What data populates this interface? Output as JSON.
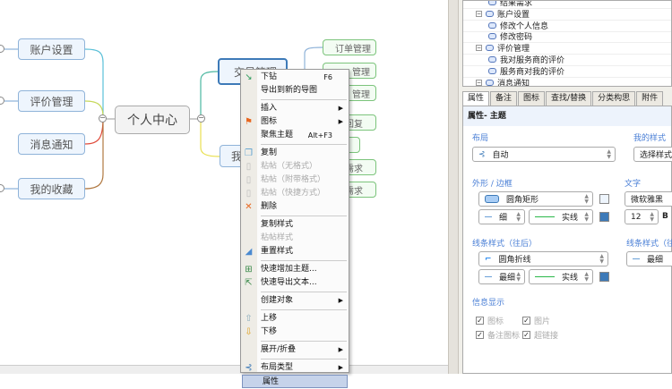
{
  "mindmap": {
    "center": "个人中心",
    "left_nodes": [
      "账户设置",
      "评价管理",
      "消息通知",
      "我的收藏"
    ],
    "right_nodes": [
      "交易管理",
      "我"
    ],
    "green_nodes": [
      "订单管理",
      "管理",
      "管理",
      "回复",
      "",
      "需求",
      "需求"
    ]
  },
  "context_menu": {
    "items": [
      {
        "label": "下钻",
        "shortcut": "F6",
        "icon": "drill-down-icon"
      },
      {
        "label": "导出到新的导图"
      },
      {
        "sep": true
      },
      {
        "label": "插入",
        "submenu": true
      },
      {
        "label": "图标",
        "submenu": true,
        "icon": "flag-icon"
      },
      {
        "label": "聚焦主题",
        "shortcut": "Alt+F3"
      },
      {
        "sep": true
      },
      {
        "label": "复制",
        "icon": "copy-icon"
      },
      {
        "label": "粘帖（无格式）",
        "disabled": true,
        "icon": "paste-icon"
      },
      {
        "label": "粘帖（附带格式）",
        "disabled": true,
        "icon": "paste-icon"
      },
      {
        "label": "粘帖（快捷方式）",
        "disabled": true,
        "icon": "paste-icon"
      },
      {
        "label": "删除",
        "icon": "delete-icon"
      },
      {
        "sep": true
      },
      {
        "label": "复制样式"
      },
      {
        "label": "粘帖样式",
        "disabled": true
      },
      {
        "label": "重置样式",
        "icon": "eraser-icon"
      },
      {
        "sep": true
      },
      {
        "label": "快速增加主题...",
        "icon": "add-topic-icon"
      },
      {
        "label": "快速导出文本...",
        "icon": "export-text-icon"
      },
      {
        "sep": true
      },
      {
        "label": "创建对象",
        "submenu": true
      },
      {
        "sep": true
      },
      {
        "label": "上移",
        "icon": "move-up-icon"
      },
      {
        "label": "下移",
        "icon": "move-down-icon"
      },
      {
        "sep": true
      },
      {
        "label": "展开/折叠",
        "submenu": true
      },
      {
        "sep": true
      },
      {
        "label": "布局类型",
        "submenu": true,
        "icon": "layout-icon"
      },
      {
        "label": "属性",
        "selected": true
      }
    ]
  },
  "tree": {
    "items": [
      {
        "label": "结果需求",
        "level": 2
      },
      {
        "label": "账户设置",
        "level": 1
      },
      {
        "label": "修改个人信息",
        "level": 2
      },
      {
        "label": "修改密码",
        "level": 2
      },
      {
        "label": "评价管理",
        "level": 1
      },
      {
        "label": "我对服务商的评价",
        "level": 2
      },
      {
        "label": "服务商对我的评价",
        "level": 2
      },
      {
        "label": "消息通知",
        "level": 1
      }
    ]
  },
  "tabs": [
    "属性",
    "备注",
    "图标",
    "查找/替换",
    "分类构思",
    "附件"
  ],
  "properties": {
    "header": "属性- 主题",
    "layout_label": "布局",
    "layout_value": "自动",
    "my_style_label": "我的样式",
    "my_style_value": "选择样式并应用",
    "shape_label": "外形 / 边框",
    "shape_value": "圆角矩形",
    "border_width": "细",
    "border_style": "实线",
    "text_label": "文字",
    "font_value": "微软雅黑",
    "font_size": "12",
    "bold": "B",
    "line_after_label": "线条样式（往后）",
    "line_shape": "圆角折线",
    "line_width": "最细",
    "line_style": "实线",
    "line_before_label": "线条样式（往前）",
    "line_before_width": "最细",
    "info_label": "信息显示",
    "checks": [
      {
        "label": "图标",
        "checked": true
      },
      {
        "label": "图片",
        "checked": true
      },
      {
        "label": "备注图标",
        "checked": true
      },
      {
        "label": "超链接",
        "checked": true
      }
    ],
    "fill_color": "#eef5fd",
    "border_color": "#3d7ab8",
    "line_color": "#3d7ab8"
  }
}
